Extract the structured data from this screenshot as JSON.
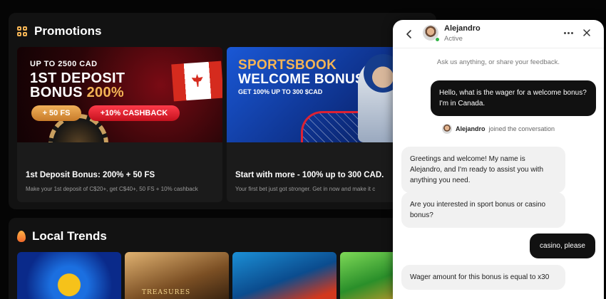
{
  "promotions": {
    "title": "Promotions",
    "cards": [
      {
        "banner_top": "UP TO 2500 CAD",
        "banner_line1": "1ST DEPOSIT",
        "banner_line2": "BONUS ",
        "banner_line2_highlight": "200%",
        "pill_fs": "+ 50 FS",
        "pill_cashback": "+10% CASHBACK",
        "title": "1st Deposit Bonus: 200% + 50 FS",
        "description": "Make your 1st deposit of C$20+, get C$40+, 50 FS + 10% cashback"
      },
      {
        "banner_line1": "SPORTSBOOK",
        "banner_line2": "WELCOME BONUS",
        "banner_sub": "GET 100% UP TO 300 $CAD",
        "title": "Start with more - 100% up to 300 CAD.",
        "description": "Your first bet just got stronger. Get in now and make it c"
      }
    ]
  },
  "trends": {
    "title": "Local Trends",
    "games": [
      {
        "icon": "lightning-coin"
      },
      {
        "icon": "treasure-princess",
        "tag": "TREASURES"
      },
      {
        "icon": "fish-reel"
      },
      {
        "icon": "leprechaun"
      }
    ]
  },
  "chat": {
    "agent_name": "Alejandro",
    "agent_status": "Active",
    "hint": "Ask us anything, or share your feedback.",
    "messages": [
      {
        "from": "user",
        "text": "Hello, what is the wager for a welcome bonus? I'm in Canada."
      },
      {
        "from": "agent",
        "text": "Greetings and welcome! My name is Alejandro, and I'm ready to assist you with anything you need."
      },
      {
        "from": "agent",
        "text": "Are you interested in sport bonus or casino bonus?"
      },
      {
        "from": "user",
        "text": "casino, please"
      },
      {
        "from": "agent",
        "text": "Wager amount for this bonus is equal to x30"
      }
    ],
    "join_name": "Alejandro",
    "join_text": "joined the conversation"
  }
}
